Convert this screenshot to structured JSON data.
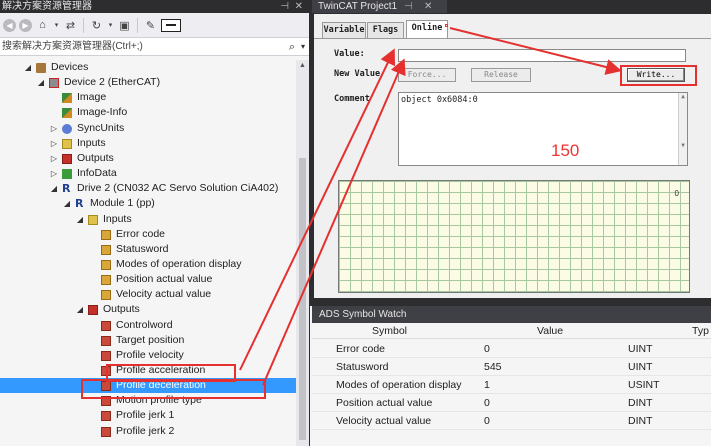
{
  "left_panel": {
    "title": "解决方案资源管理器",
    "search_placeholder": "搜索解决方案资源管理器(Ctrl+;)",
    "tree": [
      {
        "label": "Devices",
        "indent": 3,
        "icon": "dev",
        "twisty": "◢"
      },
      {
        "label": "Device 2 (EtherCAT)",
        "indent": 4,
        "icon": "ecat",
        "twisty": "◢"
      },
      {
        "label": "Image",
        "indent": 5,
        "icon": "img",
        "twisty": ""
      },
      {
        "label": "Image-Info",
        "indent": 5,
        "icon": "img",
        "twisty": ""
      },
      {
        "label": "SyncUnits",
        "indent": 5,
        "icon": "sync",
        "twisty": "▷"
      },
      {
        "label": "Inputs",
        "indent": 5,
        "icon": "in",
        "twisty": "▷"
      },
      {
        "label": "Outputs",
        "indent": 5,
        "icon": "out",
        "twisty": "▷"
      },
      {
        "label": "InfoData",
        "indent": 5,
        "icon": "info",
        "twisty": "▷"
      },
      {
        "label": "Drive 2 (CN032 AC Servo Solution CiA402)",
        "indent": 5,
        "icon": "r",
        "twisty": "◢"
      },
      {
        "label": "Module 1 (pp)",
        "indent": 6,
        "icon": "r",
        "twisty": "◢"
      },
      {
        "label": "Inputs",
        "indent": 7,
        "icon": "in",
        "twisty": "◢"
      },
      {
        "label": "Error code",
        "indent": 8,
        "icon": "var-in",
        "twisty": ""
      },
      {
        "label": "Statusword",
        "indent": 8,
        "icon": "var-in",
        "twisty": ""
      },
      {
        "label": "Modes of operation display",
        "indent": 8,
        "icon": "var-in",
        "twisty": ""
      },
      {
        "label": "Position actual value",
        "indent": 8,
        "icon": "var-in",
        "twisty": ""
      },
      {
        "label": "Velocity actual value",
        "indent": 8,
        "icon": "var-in",
        "twisty": ""
      },
      {
        "label": "Outputs",
        "indent": 7,
        "icon": "out",
        "twisty": "◢"
      },
      {
        "label": "Controlword",
        "indent": 8,
        "icon": "var-out",
        "twisty": ""
      },
      {
        "label": "Target position",
        "indent": 8,
        "icon": "var-out",
        "twisty": ""
      },
      {
        "label": "Profile velocity",
        "indent": 8,
        "icon": "var-out",
        "twisty": ""
      },
      {
        "label": "Profile acceleration",
        "indent": 8,
        "icon": "var-out",
        "twisty": ""
      },
      {
        "label": "Profile deceleration",
        "indent": 8,
        "icon": "var-out",
        "twisty": "",
        "selected": true
      },
      {
        "label": "Motion profile type",
        "indent": 8,
        "icon": "var-out",
        "twisty": ""
      },
      {
        "label": "Profile jerk 1",
        "indent": 8,
        "icon": "var-out",
        "twisty": ""
      },
      {
        "label": "Profile jerk 2",
        "indent": 8,
        "icon": "var-out",
        "twisty": ""
      }
    ]
  },
  "twincat": {
    "tab_title": "TwinCAT Project1",
    "tabs": [
      "Variable",
      "Flags",
      "Online"
    ],
    "active_tab": "Online",
    "value_label": "Value:",
    "value": "",
    "new_value_label": "New Value",
    "force_button": "Force...",
    "release_button": "Release",
    "write_button": "Write...",
    "comment_label": "Comment",
    "comment_text": "object 0x6084:0",
    "annotation_value": "150",
    "chart_zero_label": "0"
  },
  "ads": {
    "title": "ADS Symbol Watch",
    "columns": [
      "Symbol",
      "Value",
      "Typ"
    ],
    "rows": [
      {
        "symbol": "Error code",
        "value": "0",
        "type": "UINT"
      },
      {
        "symbol": "Statusword",
        "value": "545",
        "type": "UINT"
      },
      {
        "symbol": "Modes of operation display",
        "value": "1",
        "type": "USINT"
      },
      {
        "symbol": "Position actual value",
        "value": "0",
        "type": "DINT"
      },
      {
        "symbol": "Velocity actual value",
        "value": "0",
        "type": "DINT"
      }
    ]
  },
  "colors": {
    "accent_red": "#e53030",
    "selection_blue": "#3399ff",
    "dark_chrome": "#2d2d30"
  }
}
